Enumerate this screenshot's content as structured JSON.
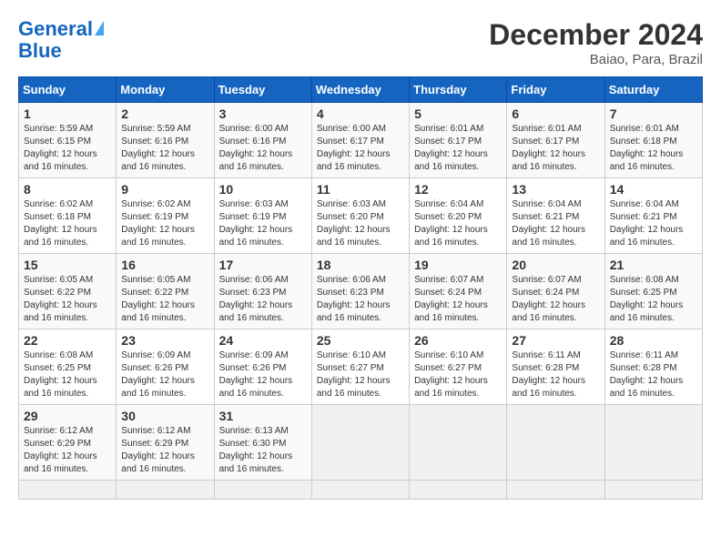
{
  "header": {
    "logo_line1": "General",
    "logo_line2": "Blue",
    "month_title": "December 2024",
    "location": "Baiao, Para, Brazil"
  },
  "calendar": {
    "days_of_week": [
      "Sunday",
      "Monday",
      "Tuesday",
      "Wednesday",
      "Thursday",
      "Friday",
      "Saturday"
    ],
    "weeks": [
      [
        null,
        null,
        null,
        null,
        null,
        null,
        null
      ],
      [
        null,
        null,
        null,
        null,
        null,
        null,
        null
      ],
      [
        null,
        null,
        null,
        null,
        null,
        null,
        null
      ],
      [
        null,
        null,
        null,
        null,
        null,
        null,
        null
      ],
      [
        null,
        null,
        null,
        null,
        null,
        null,
        null
      ],
      [
        null,
        null,
        null,
        null,
        null,
        null,
        null
      ]
    ],
    "cells": [
      {
        "day": 1,
        "col": 0,
        "sunrise": "5:59 AM",
        "sunset": "6:15 PM",
        "daylight": "12 hours and 16 minutes"
      },
      {
        "day": 2,
        "col": 1,
        "sunrise": "5:59 AM",
        "sunset": "6:16 PM",
        "daylight": "12 hours and 16 minutes"
      },
      {
        "day": 3,
        "col": 2,
        "sunrise": "6:00 AM",
        "sunset": "6:16 PM",
        "daylight": "12 hours and 16 minutes"
      },
      {
        "day": 4,
        "col": 3,
        "sunrise": "6:00 AM",
        "sunset": "6:17 PM",
        "daylight": "12 hours and 16 minutes"
      },
      {
        "day": 5,
        "col": 4,
        "sunrise": "6:01 AM",
        "sunset": "6:17 PM",
        "daylight": "12 hours and 16 minutes"
      },
      {
        "day": 6,
        "col": 5,
        "sunrise": "6:01 AM",
        "sunset": "6:17 PM",
        "daylight": "12 hours and 16 minutes"
      },
      {
        "day": 7,
        "col": 6,
        "sunrise": "6:01 AM",
        "sunset": "6:18 PM",
        "daylight": "12 hours and 16 minutes"
      },
      {
        "day": 8,
        "col": 0,
        "sunrise": "6:02 AM",
        "sunset": "6:18 PM",
        "daylight": "12 hours and 16 minutes"
      },
      {
        "day": 9,
        "col": 1,
        "sunrise": "6:02 AM",
        "sunset": "6:19 PM",
        "daylight": "12 hours and 16 minutes"
      },
      {
        "day": 10,
        "col": 2,
        "sunrise": "6:03 AM",
        "sunset": "6:19 PM",
        "daylight": "12 hours and 16 minutes"
      },
      {
        "day": 11,
        "col": 3,
        "sunrise": "6:03 AM",
        "sunset": "6:20 PM",
        "daylight": "12 hours and 16 minutes"
      },
      {
        "day": 12,
        "col": 4,
        "sunrise": "6:04 AM",
        "sunset": "6:20 PM",
        "daylight": "12 hours and 16 minutes"
      },
      {
        "day": 13,
        "col": 5,
        "sunrise": "6:04 AM",
        "sunset": "6:21 PM",
        "daylight": "12 hours and 16 minutes"
      },
      {
        "day": 14,
        "col": 6,
        "sunrise": "6:04 AM",
        "sunset": "6:21 PM",
        "daylight": "12 hours and 16 minutes"
      },
      {
        "day": 15,
        "col": 0,
        "sunrise": "6:05 AM",
        "sunset": "6:22 PM",
        "daylight": "12 hours and 16 minutes"
      },
      {
        "day": 16,
        "col": 1,
        "sunrise": "6:05 AM",
        "sunset": "6:22 PM",
        "daylight": "12 hours and 16 minutes"
      },
      {
        "day": 17,
        "col": 2,
        "sunrise": "6:06 AM",
        "sunset": "6:23 PM",
        "daylight": "12 hours and 16 minutes"
      },
      {
        "day": 18,
        "col": 3,
        "sunrise": "6:06 AM",
        "sunset": "6:23 PM",
        "daylight": "12 hours and 16 minutes"
      },
      {
        "day": 19,
        "col": 4,
        "sunrise": "6:07 AM",
        "sunset": "6:24 PM",
        "daylight": "12 hours and 16 minutes"
      },
      {
        "day": 20,
        "col": 5,
        "sunrise": "6:07 AM",
        "sunset": "6:24 PM",
        "daylight": "12 hours and 16 minutes"
      },
      {
        "day": 21,
        "col": 6,
        "sunrise": "6:08 AM",
        "sunset": "6:25 PM",
        "daylight": "12 hours and 16 minutes"
      },
      {
        "day": 22,
        "col": 0,
        "sunrise": "6:08 AM",
        "sunset": "6:25 PM",
        "daylight": "12 hours and 16 minutes"
      },
      {
        "day": 23,
        "col": 1,
        "sunrise": "6:09 AM",
        "sunset": "6:26 PM",
        "daylight": "12 hours and 16 minutes"
      },
      {
        "day": 24,
        "col": 2,
        "sunrise": "6:09 AM",
        "sunset": "6:26 PM",
        "daylight": "12 hours and 16 minutes"
      },
      {
        "day": 25,
        "col": 3,
        "sunrise": "6:10 AM",
        "sunset": "6:27 PM",
        "daylight": "12 hours and 16 minutes"
      },
      {
        "day": 26,
        "col": 4,
        "sunrise": "6:10 AM",
        "sunset": "6:27 PM",
        "daylight": "12 hours and 16 minutes"
      },
      {
        "day": 27,
        "col": 5,
        "sunrise": "6:11 AM",
        "sunset": "6:28 PM",
        "daylight": "12 hours and 16 minutes"
      },
      {
        "day": 28,
        "col": 6,
        "sunrise": "6:11 AM",
        "sunset": "6:28 PM",
        "daylight": "12 hours and 16 minutes"
      },
      {
        "day": 29,
        "col": 0,
        "sunrise": "6:12 AM",
        "sunset": "6:29 PM",
        "daylight": "12 hours and 16 minutes"
      },
      {
        "day": 30,
        "col": 1,
        "sunrise": "6:12 AM",
        "sunset": "6:29 PM",
        "daylight": "12 hours and 16 minutes"
      },
      {
        "day": 31,
        "col": 2,
        "sunrise": "6:13 AM",
        "sunset": "6:30 PM",
        "daylight": "12 hours and 16 minutes"
      }
    ]
  }
}
